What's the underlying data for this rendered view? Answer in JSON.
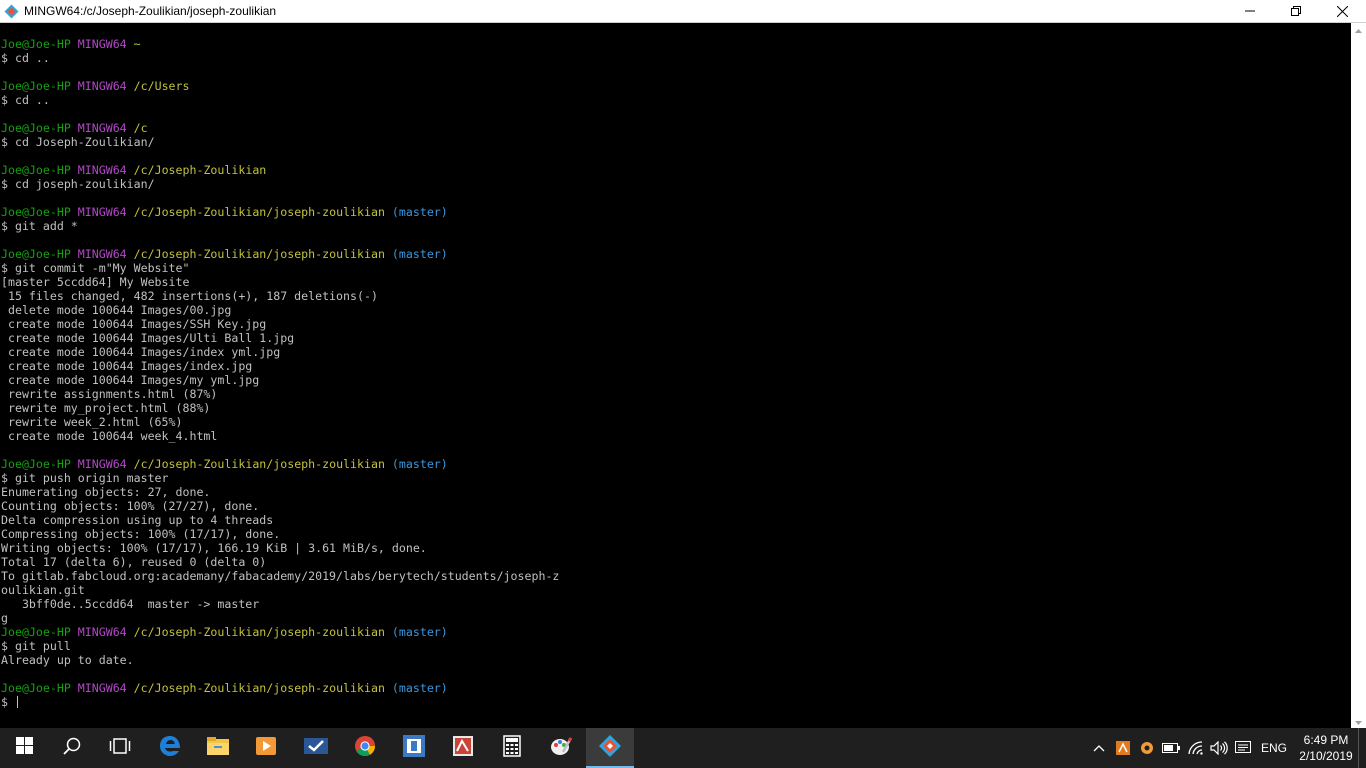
{
  "window": {
    "title": "MINGW64:/c/Joseph-Zoulikian/joseph-zoulikian",
    "icon": "git-bash-icon",
    "controls": [
      "minimize-icon",
      "maximize-icon",
      "close-icon"
    ]
  },
  "colors": {
    "user": "#13a10e",
    "host": "#b148c6",
    "path": "#c1c13d",
    "branch": "#3a96dd",
    "text": "#c0c0c0",
    "background": "#000000"
  },
  "terminal": {
    "lines": [
      {
        "t": "prompt",
        "user": "Joe@Joe-HP",
        "host": "MINGW64",
        "path": "~",
        "branch": ""
      },
      {
        "t": "text",
        "text": "$ cd .."
      },
      {
        "t": "text",
        "text": ""
      },
      {
        "t": "prompt",
        "user": "Joe@Joe-HP",
        "host": "MINGW64",
        "path": "/c/Users",
        "branch": ""
      },
      {
        "t": "text",
        "text": "$ cd .."
      },
      {
        "t": "text",
        "text": ""
      },
      {
        "t": "prompt",
        "user": "Joe@Joe-HP",
        "host": "MINGW64",
        "path": "/c",
        "branch": ""
      },
      {
        "t": "text",
        "text": "$ cd Joseph-Zoulikian/"
      },
      {
        "t": "text",
        "text": ""
      },
      {
        "t": "prompt",
        "user": "Joe@Joe-HP",
        "host": "MINGW64",
        "path": "/c/Joseph-Zoulikian",
        "branch": ""
      },
      {
        "t": "text",
        "text": "$ cd joseph-zoulikian/"
      },
      {
        "t": "text",
        "text": ""
      },
      {
        "t": "prompt",
        "user": "Joe@Joe-HP",
        "host": "MINGW64",
        "path": "/c/Joseph-Zoulikian/joseph-zoulikian",
        "branch": "(master)"
      },
      {
        "t": "text",
        "text": "$ git add *"
      },
      {
        "t": "text",
        "text": ""
      },
      {
        "t": "prompt",
        "user": "Joe@Joe-HP",
        "host": "MINGW64",
        "path": "/c/Joseph-Zoulikian/joseph-zoulikian",
        "branch": "(master)"
      },
      {
        "t": "text",
        "text": "$ git commit -m\"My Website\""
      },
      {
        "t": "text",
        "text": "[master 5ccdd64] My Website"
      },
      {
        "t": "text",
        "text": " 15 files changed, 482 insertions(+), 187 deletions(-)"
      },
      {
        "t": "text",
        "text": " delete mode 100644 Images/00.jpg"
      },
      {
        "t": "text",
        "text": " create mode 100644 Images/SSH Key.jpg"
      },
      {
        "t": "text",
        "text": " create mode 100644 Images/Ulti Ball 1.jpg"
      },
      {
        "t": "text",
        "text": " create mode 100644 Images/index yml.jpg"
      },
      {
        "t": "text",
        "text": " create mode 100644 Images/index.jpg"
      },
      {
        "t": "text",
        "text": " create mode 100644 Images/my yml.jpg"
      },
      {
        "t": "text",
        "text": " rewrite assignments.html (87%)"
      },
      {
        "t": "text",
        "text": " rewrite my_project.html (88%)"
      },
      {
        "t": "text",
        "text": " rewrite week_2.html (65%)"
      },
      {
        "t": "text",
        "text": " create mode 100644 week_4.html"
      },
      {
        "t": "text",
        "text": ""
      },
      {
        "t": "prompt",
        "user": "Joe@Joe-HP",
        "host": "MINGW64",
        "path": "/c/Joseph-Zoulikian/joseph-zoulikian",
        "branch": "(master)"
      },
      {
        "t": "text",
        "text": "$ git push origin master"
      },
      {
        "t": "text",
        "text": "Enumerating objects: 27, done."
      },
      {
        "t": "text",
        "text": "Counting objects: 100% (27/27), done."
      },
      {
        "t": "text",
        "text": "Delta compression using up to 4 threads"
      },
      {
        "t": "text",
        "text": "Compressing objects: 100% (17/17), done."
      },
      {
        "t": "text",
        "text": "Writing objects: 100% (17/17), 166.19 KiB | 3.61 MiB/s, done."
      },
      {
        "t": "text",
        "text": "Total 17 (delta 6), reused 0 (delta 0)"
      },
      {
        "t": "text",
        "text": "To gitlab.fabcloud.org:academany/fabacademy/2019/labs/berytech/students/joseph-z"
      },
      {
        "t": "text",
        "text": "oulikian.git"
      },
      {
        "t": "text",
        "text": "   3bff0de..5ccdd64  master -> master"
      },
      {
        "t": "text",
        "text": "g"
      },
      {
        "t": "prompt",
        "user": "Joe@Joe-HP",
        "host": "MINGW64",
        "path": "/c/Joseph-Zoulikian/joseph-zoulikian",
        "branch": "(master)"
      },
      {
        "t": "text",
        "text": "$ git pull"
      },
      {
        "t": "text",
        "text": "Already up to date."
      },
      {
        "t": "text",
        "text": ""
      },
      {
        "t": "prompt",
        "user": "Joe@Joe-HP",
        "host": "MINGW64",
        "path": "/c/Joseph-Zoulikian/joseph-zoulikian",
        "branch": "(master)"
      },
      {
        "t": "input",
        "text": "$ "
      }
    ]
  },
  "taskbar": {
    "items": [
      {
        "name": "start-button",
        "icon": "windows-logo-icon"
      },
      {
        "name": "search-button",
        "icon": "search-icon"
      },
      {
        "name": "task-view-button",
        "icon": "task-view-icon"
      },
      {
        "name": "edge-taskbar-item",
        "icon": "edge-icon"
      },
      {
        "name": "file-explorer-taskbar-item",
        "icon": "folder-icon"
      },
      {
        "name": "media-player-taskbar-item",
        "icon": "media-player-icon"
      },
      {
        "name": "tasks-taskbar-item",
        "icon": "checkmark-app-icon"
      },
      {
        "name": "chrome-taskbar-item",
        "icon": "chrome-icon"
      },
      {
        "name": "app-taskbar-item",
        "icon": "app-window-icon"
      },
      {
        "name": "image-app-taskbar-item",
        "icon": "image-app-icon"
      },
      {
        "name": "calculator-taskbar-item",
        "icon": "calculator-icon"
      },
      {
        "name": "paint-taskbar-item",
        "icon": "paint-icon"
      },
      {
        "name": "git-bash-taskbar-item",
        "icon": "git-bash-icon",
        "active": true
      }
    ],
    "tray": {
      "icons": [
        "chevron-up-icon",
        "tray-app-icon-1",
        "tray-app-icon-2",
        "battery-icon",
        "wifi-icon",
        "volume-icon",
        "action-center-icon"
      ],
      "language": "ENG",
      "time": "6:49 PM",
      "date": "2/10/2019"
    }
  }
}
